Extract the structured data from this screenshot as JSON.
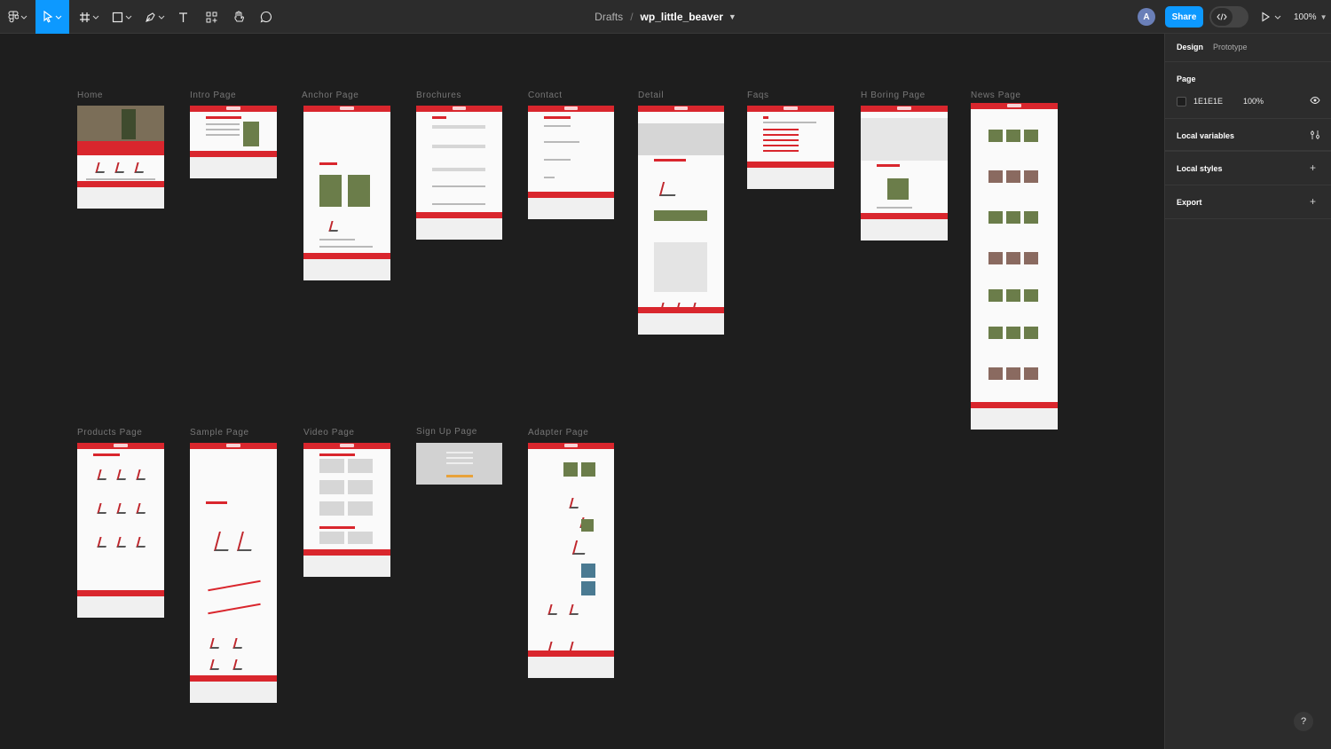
{
  "toolbar": {
    "breadcrumb_drafts": "Drafts",
    "breadcrumb_sep": "/",
    "file_name": "wp_little_beaver",
    "avatar_initial": "A",
    "share_label": "Share",
    "zoom_label": "100%"
  },
  "frames": [
    {
      "label": "Home"
    },
    {
      "label": "Intro Page"
    },
    {
      "label": "Anchor Page"
    },
    {
      "label": "Brochures"
    },
    {
      "label": "Contact"
    },
    {
      "label": "Detail"
    },
    {
      "label": "Faqs"
    },
    {
      "label": "H Boring Page"
    },
    {
      "label": "News Page"
    },
    {
      "label": "Products Page"
    },
    {
      "label": "Sample Page"
    },
    {
      "label": "Video Page"
    },
    {
      "label": "Sign Up Page"
    },
    {
      "label": "Adapter Page"
    }
  ],
  "panel": {
    "tab_design": "Design",
    "tab_prototype": "Prototype",
    "page_title": "Page",
    "page_color_hex": "1E1E1E",
    "page_opacity": "100%",
    "local_variables": "Local variables",
    "local_styles": "Local styles",
    "export": "Export",
    "help": "?"
  },
  "colors": {
    "canvas": "#1e1e1e",
    "toolbar": "#2c2c2c",
    "accent": "#0d99ff",
    "brand_red": "#d9262d"
  }
}
